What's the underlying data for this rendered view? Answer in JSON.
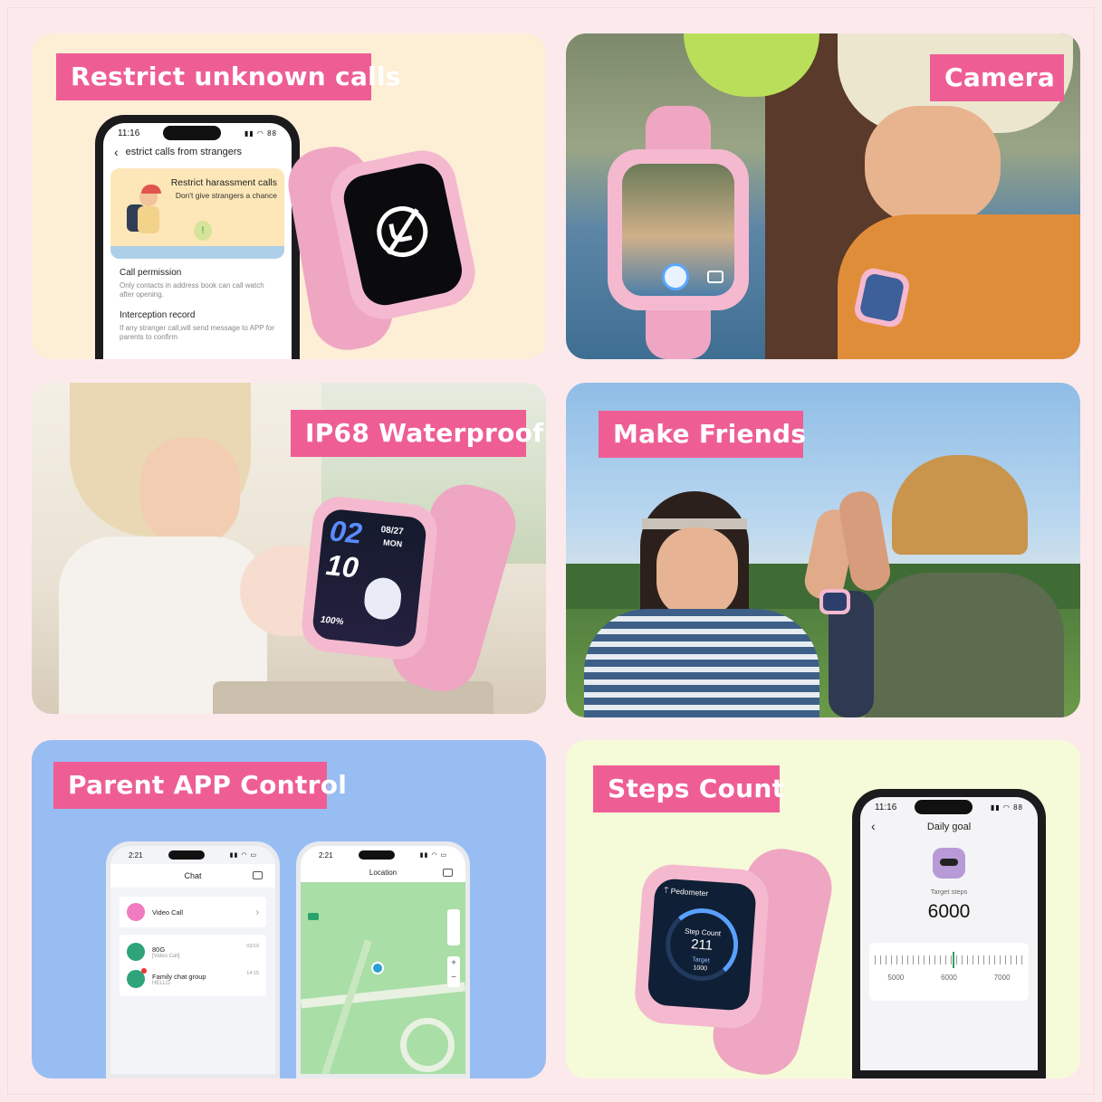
{
  "panels": {
    "restrict": {
      "tag": "Restrict unknown calls",
      "phone": {
        "time": "11:16",
        "battery": "88",
        "header": "estrict calls from strangers",
        "banner_title": "Restrict harassment calls",
        "banner_sub": "Don't give strangers a chance",
        "perm_title": "Call permission",
        "perm_desc": "Only contacts in address book can call watch after opening.",
        "intercept_title": "Interception record",
        "intercept_desc": "If any stranger call,will send message to APP for parents to confirm"
      }
    },
    "camera": {
      "tag": "Camera"
    },
    "waterproof": {
      "tag": "IP68 Waterproof",
      "watch": {
        "hour": "02",
        "minute": "10",
        "date": "08/27",
        "day": "MON",
        "battery": "100%"
      }
    },
    "friends": {
      "tag": "Make Friends"
    },
    "parent": {
      "tag": "Parent APP Control",
      "chat_phone": {
        "time": "2:21",
        "title": "Chat",
        "items": [
          {
            "name": "Video Call",
            "sub": "",
            "time": ""
          },
          {
            "name": "80G",
            "sub": "[Video Call]",
            "time": "03/10"
          },
          {
            "name": "Family chat group",
            "sub": "HELLO",
            "time": "14:15"
          }
        ]
      },
      "location_phone": {
        "time": "2:21",
        "title": "Location"
      }
    },
    "steps": {
      "tag": "Steps Count",
      "watch": {
        "app": "Pedometer",
        "label": "Step Count",
        "count": "211",
        "target_label": "Target",
        "target": "1000"
      },
      "phone": {
        "time": "11:16",
        "battery": "88",
        "title": "Daily goal",
        "target_label": "Target steps",
        "target_value": "6000",
        "ticks": [
          "5000",
          "6000",
          "7000"
        ]
      }
    }
  },
  "colors": {
    "tag": "#ee5e95",
    "watch_pink": "#f4b9cf",
    "background": "#fce9ec"
  }
}
